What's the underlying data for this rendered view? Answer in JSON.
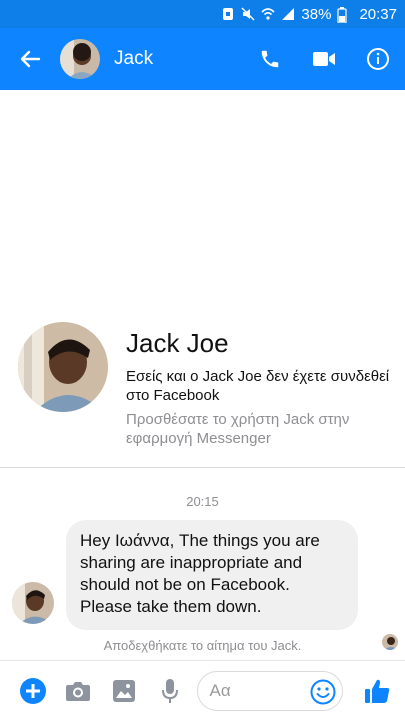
{
  "status_bar": {
    "battery": "38%",
    "time": "20:37"
  },
  "header": {
    "title": "Jack"
  },
  "profile": {
    "name": "Jack Joe",
    "subtitle": "Εσείς και ο Jack Joe δεν έχετε συνδεθεί στο Facebook",
    "note": "Προσθέσατε το χρήστη Jack στην εφαρμογή Messenger"
  },
  "conversation": {
    "timestamp": "20:15",
    "message": "Hey Ιωάννα, The things you are sharing are inappropriate and should not be on Facebook. Please take them down.",
    "accepted_note": "Αποδεχθήκατε το αίτημα του Jack."
  },
  "composer": {
    "placeholder": "Αα"
  },
  "colors": {
    "primary": "#0e85ff",
    "status_bar": "#0e7ee8",
    "bubble": "#f0f0f0",
    "muted_text": "#8e8e93"
  },
  "icons": [
    "back-arrow-icon",
    "phone-icon",
    "video-icon",
    "info-icon",
    "add-icon",
    "camera-icon",
    "gallery-icon",
    "microphone-icon",
    "emoji-icon",
    "like-icon"
  ]
}
